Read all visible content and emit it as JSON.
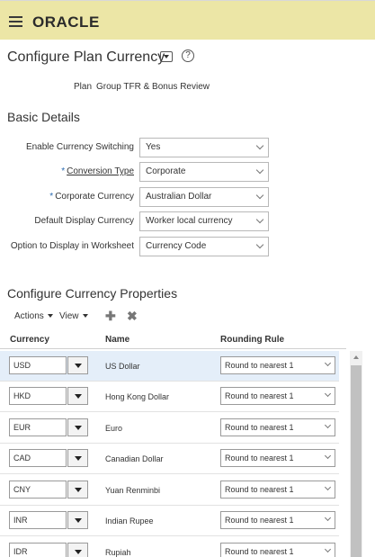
{
  "header": {
    "brand": "ORACLE"
  },
  "page": {
    "title": "Configure Plan Currency",
    "plan_label": "Plan",
    "plan_value": "Group TFR & Bonus Review"
  },
  "basic_details": {
    "title": "Basic Details",
    "fields": [
      {
        "label": "Enable Currency Switching",
        "value": "Yes"
      },
      {
        "label": "Conversion Type",
        "value": "Corporate",
        "required": true
      },
      {
        "label": "Corporate Currency",
        "value": "Australian Dollar",
        "required": true
      },
      {
        "label": "Default Display Currency",
        "value": "Worker local currency"
      },
      {
        "label": "Option to Display in Worksheet",
        "value": "Currency Code"
      }
    ]
  },
  "currency_properties": {
    "title": "Configure Currency Properties",
    "toolbar": {
      "actions": "Actions",
      "view": "View"
    },
    "columns": [
      "Currency",
      "Name",
      "Rounding Rule"
    ],
    "rows": [
      {
        "code": "USD",
        "name": "US Dollar",
        "rule": "Round to nearest 1"
      },
      {
        "code": "HKD",
        "name": "Hong Kong Dollar",
        "rule": "Round to nearest 1"
      },
      {
        "code": "EUR",
        "name": "Euro",
        "rule": "Round to nearest 1"
      },
      {
        "code": "CAD",
        "name": "Canadian Dollar",
        "rule": "Round to nearest 1"
      },
      {
        "code": "CNY",
        "name": "Yuan Renminbi",
        "rule": "Round to nearest 1"
      },
      {
        "code": "INR",
        "name": "Indian Rupee",
        "rule": "Round to nearest 1"
      },
      {
        "code": "IDR",
        "name": "Rupiah",
        "rule": "Round to nearest 1"
      }
    ]
  },
  "icons": {
    "menu": "hamburger-menu-icon",
    "title_dropdown": "dropdown-icon",
    "help": "help-icon",
    "add": "plus-icon",
    "delete": "x-icon"
  }
}
